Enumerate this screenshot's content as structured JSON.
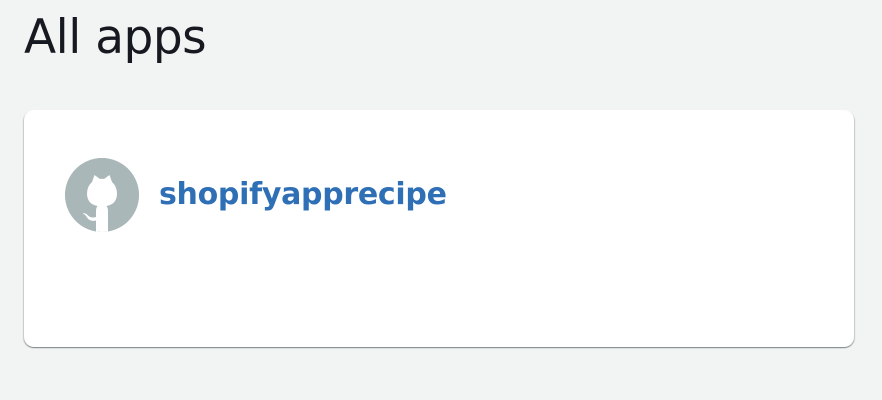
{
  "header": {
    "title": "All apps"
  },
  "apps": [
    {
      "name": "shopifyapprecipe",
      "icon": "github-icon"
    }
  ],
  "colors": {
    "background": "#f2f3f3",
    "card": "#ffffff",
    "link": "#2e6fb5",
    "avatar": "#aab7b8",
    "title": "#16191f"
  }
}
